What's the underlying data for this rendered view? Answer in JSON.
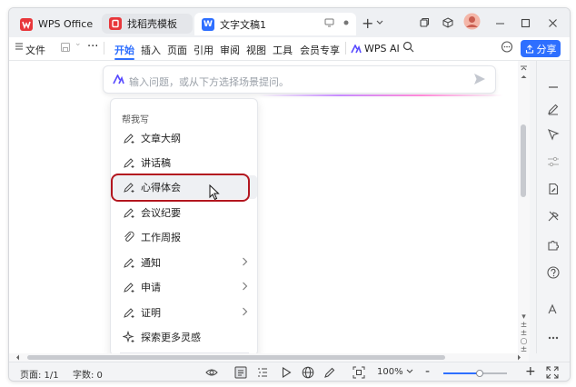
{
  "tabs": [
    {
      "label": "WPS Office",
      "icon": "wps-logo-icon",
      "color": "#e8373b"
    },
    {
      "label": "找稻壳模板",
      "icon": "docer-icon",
      "color": "#e8373b"
    },
    {
      "label": "文字文稿1",
      "icon": "word-doc-icon",
      "color": "#2e6fff"
    }
  ],
  "new_tab": "+",
  "menu": {
    "file": "文件",
    "items": [
      "开始",
      "插入",
      "页面",
      "引用",
      "审阅",
      "视图",
      "工具",
      "会员专享"
    ],
    "wps_ai": "WPS AI",
    "share": "分享"
  },
  "ai_input": {
    "placeholder": "输入问题，或从下方选择场景提问。"
  },
  "help_menu": {
    "title": "帮我写",
    "items": [
      {
        "label": "文章大纲",
        "has_submenu": false
      },
      {
        "label": "讲话稿",
        "has_submenu": false
      },
      {
        "label": "心得体会",
        "has_submenu": false,
        "hovered": true
      },
      {
        "label": "会议纪要",
        "has_submenu": false
      },
      {
        "label": "工作周报",
        "has_submenu": false
      },
      {
        "label": "通知",
        "has_submenu": true
      },
      {
        "label": "申请",
        "has_submenu": true
      },
      {
        "label": "证明",
        "has_submenu": true
      },
      {
        "label": "探索更多灵感",
        "has_submenu": false
      }
    ]
  },
  "status": {
    "page": "页面: 1/1",
    "words": "字数: 0",
    "zoom": "100%",
    "zoom_minus": "-",
    "zoom_plus": "+",
    "zoom_level_fraction": 0.57
  },
  "colors": {
    "accent": "#2e6fff",
    "highlight": "#b3161f",
    "wps_red": "#e8373b"
  }
}
